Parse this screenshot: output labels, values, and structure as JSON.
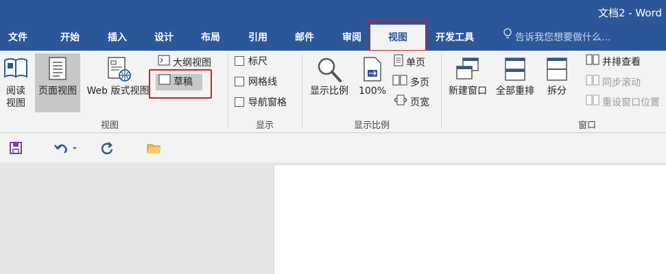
{
  "window": {
    "title": "文档2 - Word"
  },
  "tabs": [
    {
      "label": "文件"
    },
    {
      "label": "开始"
    },
    {
      "label": "插入"
    },
    {
      "label": "设计"
    },
    {
      "label": "布局"
    },
    {
      "label": "引用"
    },
    {
      "label": "邮件"
    },
    {
      "label": "审阅"
    },
    {
      "label": "视图",
      "active": true
    },
    {
      "label": "开发工具"
    }
  ],
  "tell_me": {
    "placeholder": "告诉我您想要做什么..."
  },
  "ribbon": {
    "views_group": {
      "label": "视图",
      "read_mode": "阅读\n视图",
      "print_layout": "页面视图",
      "web_layout": "Web 版式视图",
      "outline": "大纲视图",
      "draft": "草稿"
    },
    "show_group": {
      "label": "显示",
      "ruler": "标尺",
      "gridlines": "网格线",
      "nav_pane": "导航窗格"
    },
    "zoom_group": {
      "label": "显示比例",
      "zoom": "显示比例",
      "hundred": "100%",
      "one_page": "单页",
      "multiple_pages": "多页",
      "page_width": "页宽"
    },
    "window_group": {
      "label": "窗口",
      "new_window": "新建窗口",
      "arrange_all": "全部重排",
      "split": "拆分",
      "side_by_side": "并排查看",
      "sync_scroll": "同步滚动",
      "reset_position": "重设窗口位置"
    }
  },
  "colors": {
    "title_bar": "#2b579a",
    "ribbon_bg": "#f3f3f3",
    "highlight": "#c8202a"
  }
}
